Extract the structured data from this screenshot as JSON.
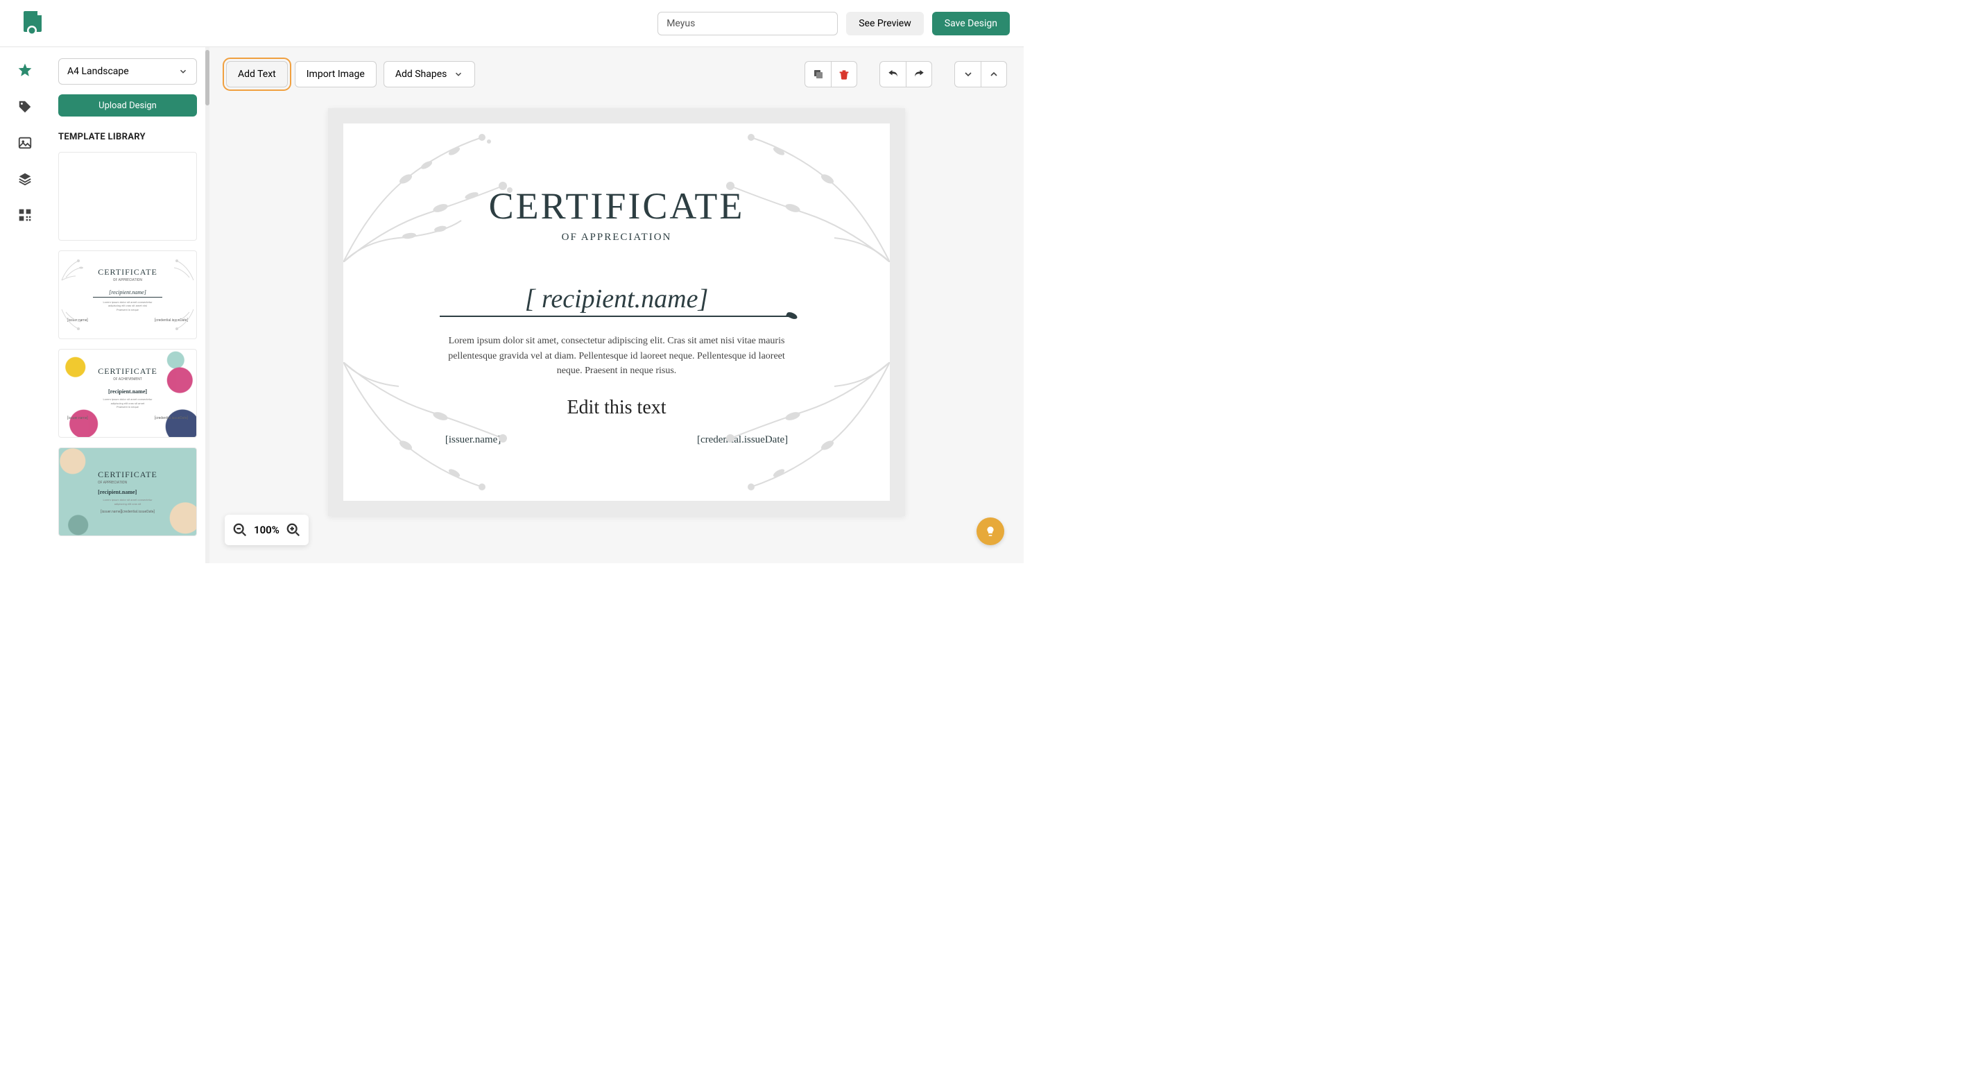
{
  "header": {
    "design_name": "Meyus",
    "preview_label": "See Preview",
    "save_label": "Save Design"
  },
  "sidebar": {
    "size_selected": "A4 Landscape",
    "upload_label": "Upload Design",
    "library_heading": "TEMPLATE LIBRARY"
  },
  "toolbar": {
    "add_text": "Add Text",
    "import_image": "Import Image",
    "add_shapes": "Add Shapes"
  },
  "certificate": {
    "title": "CERTIFICATE",
    "subtitle": "OF APPRECIATION",
    "recipient": "[ recipient.name]",
    "body": "Lorem ipsum dolor sit amet, consectetur adipiscing elit. Cras sit amet nisi vitae mauris pellentesque gravida vel at diam. Pellentesque id laoreet neque. Pellentesque id laoreet neque. Praesent in neque risus.",
    "edit_text": "Edit this text",
    "issuer": "[issuer.name]",
    "issue_date": "[credential.issueDate]"
  },
  "templates": {
    "t1": {
      "title": "CERTIFICATE",
      "sub": "OF APPRECIATION",
      "name": "[recipient.name]",
      "issuer": "[issuer.name]",
      "date": "[credential.issueDate]"
    },
    "t2": {
      "title": "CERTIFICATE",
      "sub": "OF ACHIEVEMENT",
      "name": "[recipient.name]",
      "issuer": "[issuer.name]",
      "date": "[credential.issueDate]"
    },
    "t3": {
      "title": "CERTIFICATE",
      "sub": "OF APPRECIATION",
      "name": "[recipient.name]",
      "issuer": "[issuer.name]",
      "date": "[credential.issueDate]"
    }
  },
  "zoom": {
    "value": "100%"
  },
  "colors": {
    "primary": "#2b8a6e",
    "accent": "#f0a040",
    "danger": "#d9372c"
  }
}
